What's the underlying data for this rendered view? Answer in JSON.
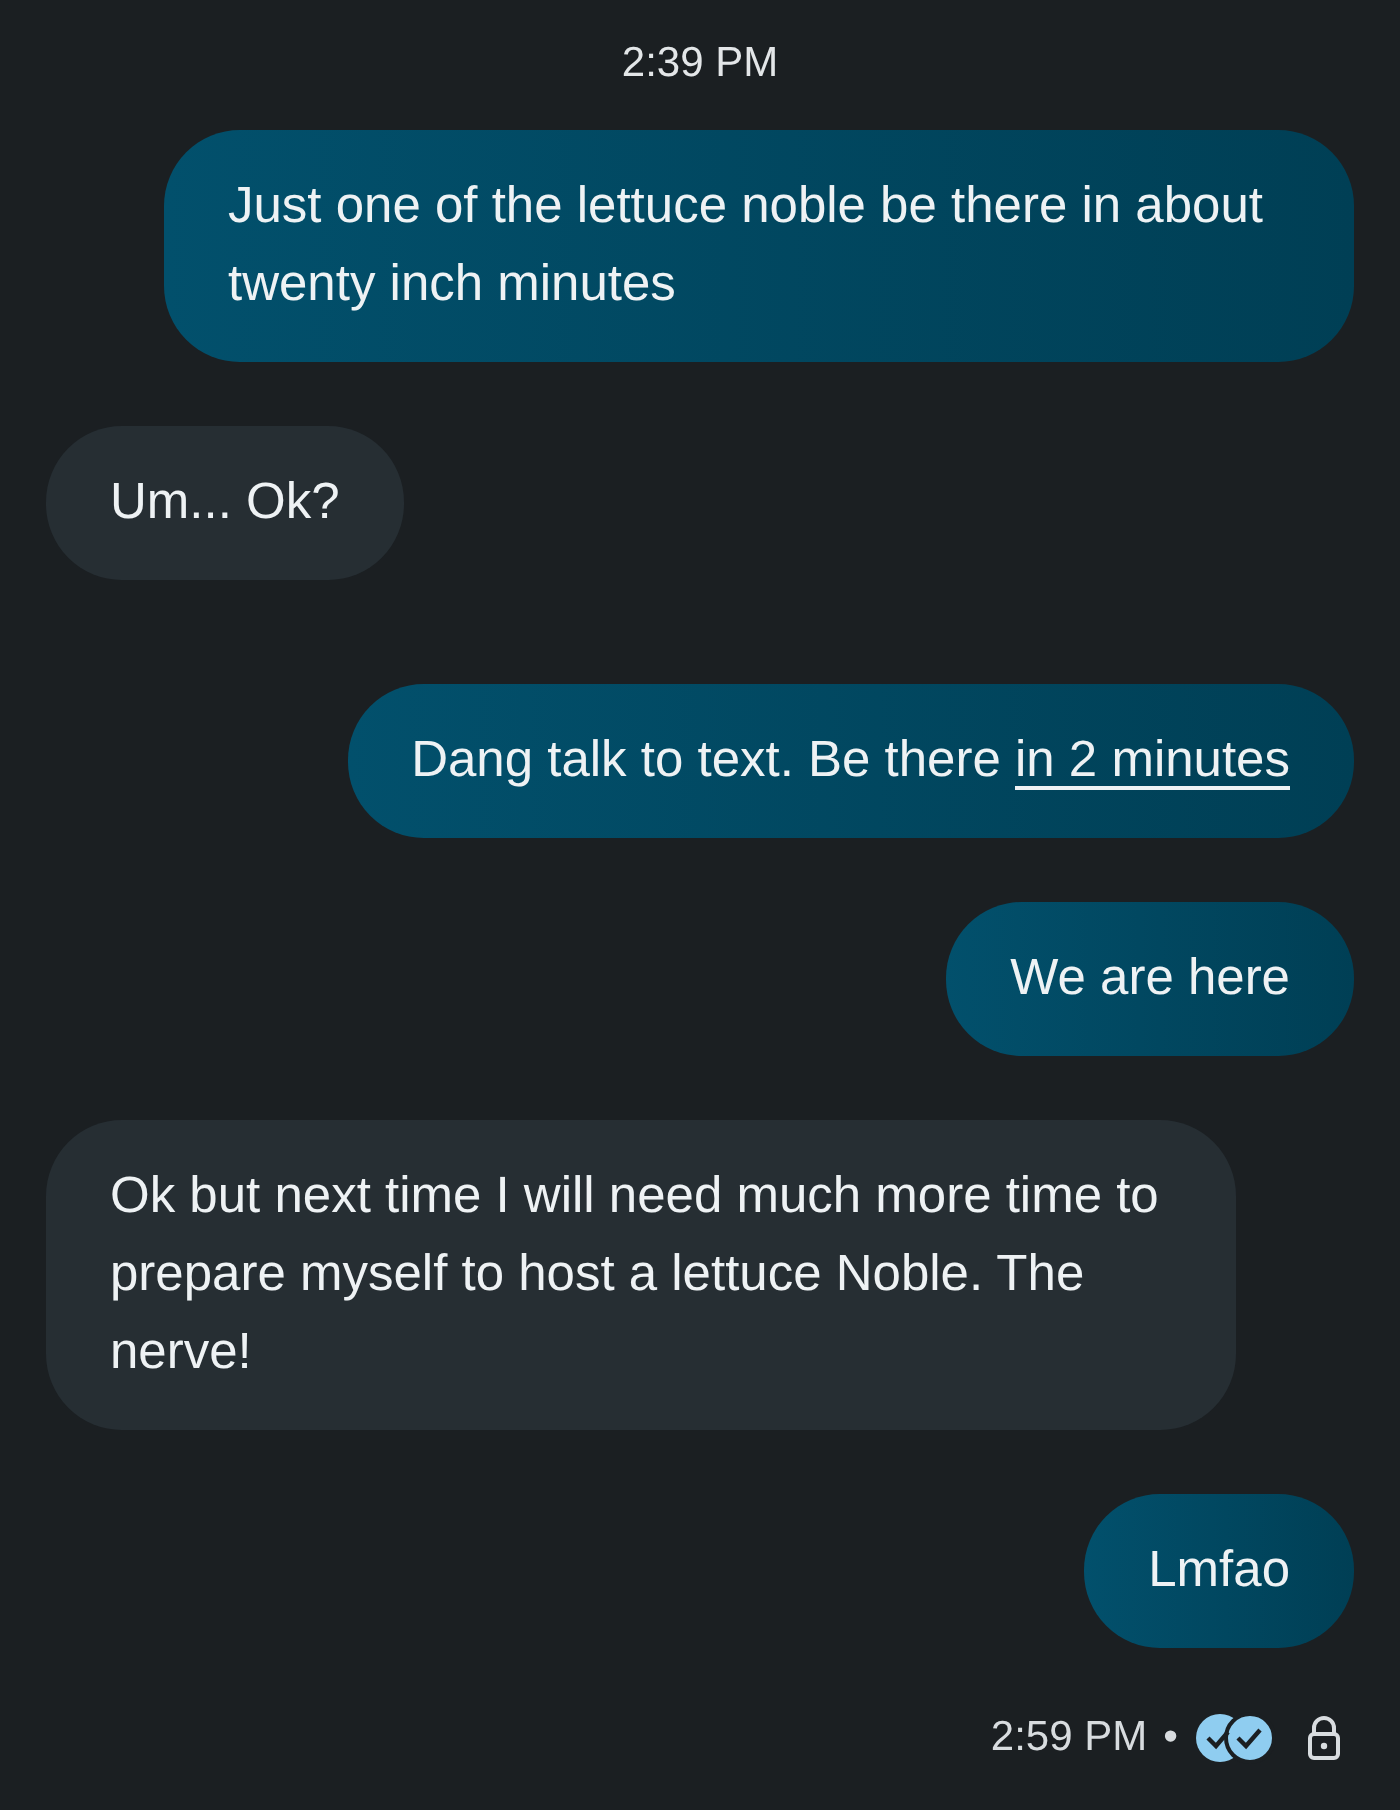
{
  "timestamp": "2:39 PM",
  "messages": [
    {
      "kind": "sent",
      "text": "Just one of the lettuce noble be there in about twenty inch minutes"
    },
    {
      "kind": "received",
      "text": "Um... Ok?"
    },
    {
      "kind": "sent",
      "text": "Dang talk to text. Be there ",
      "link": "in 2 minutes"
    },
    {
      "kind": "sent",
      "text": "We are here"
    },
    {
      "kind": "received",
      "text": "Ok but next time I will need much more time to prepare myself to host a lettuce Noble. The nerve!"
    },
    {
      "kind": "sent",
      "text": "Lmfao"
    }
  ],
  "status": {
    "time": "2:59 PM",
    "separator": "•"
  }
}
